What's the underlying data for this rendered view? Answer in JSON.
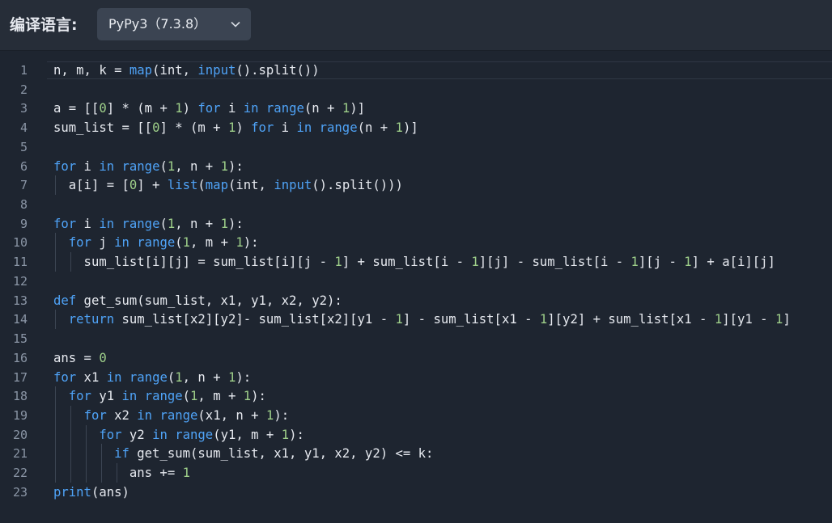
{
  "header": {
    "lang_label": "编译语言:",
    "selected_language": "PyPy3（7.3.8）"
  },
  "icons": {
    "dropdown": "chevron-down-icon"
  },
  "colors": {
    "background": "#1e2530",
    "keyword": "#4fa3f7",
    "number": "#9fd08a",
    "text": "#e6e9ef"
  },
  "editor": {
    "lines": [
      {
        "num": "1",
        "code": "n, m, k = map(int, input().split())"
      },
      {
        "num": "2",
        "code": ""
      },
      {
        "num": "3",
        "code": "a = [[0] * (m + 1) for i in range(n + 1)]"
      },
      {
        "num": "4",
        "code": "sum_list = [[0] * (m + 1) for i in range(n + 1)]"
      },
      {
        "num": "5",
        "code": ""
      },
      {
        "num": "6",
        "code": "for i in range(1, n + 1):"
      },
      {
        "num": "7",
        "code": "  a[i] = [0] + list(map(int, input().split()))"
      },
      {
        "num": "8",
        "code": ""
      },
      {
        "num": "9",
        "code": "for i in range(1, n + 1):"
      },
      {
        "num": "10",
        "code": "  for j in range(1, m + 1):"
      },
      {
        "num": "11",
        "code": "    sum_list[i][j] = sum_list[i][j - 1] + sum_list[i - 1][j] - sum_list[i - 1][j - 1] + a[i][j]"
      },
      {
        "num": "12",
        "code": ""
      },
      {
        "num": "13",
        "code": "def get_sum(sum_list, x1, y1, x2, y2):"
      },
      {
        "num": "14",
        "code": "  return sum_list[x2][y2]- sum_list[x2][y1 - 1] - sum_list[x1 - 1][y2] + sum_list[x1 - 1][y1 - 1]"
      },
      {
        "num": "15",
        "code": ""
      },
      {
        "num": "16",
        "code": "ans = 0"
      },
      {
        "num": "17",
        "code": "for x1 in range(1, n + 1):"
      },
      {
        "num": "18",
        "code": "  for y1 in range(1, m + 1):"
      },
      {
        "num": "19",
        "code": "    for x2 in range(x1, n + 1):"
      },
      {
        "num": "20",
        "code": "      for y2 in range(y1, m + 1):"
      },
      {
        "num": "21",
        "code": "        if get_sum(sum_list, x1, y1, x2, y2) <= k:"
      },
      {
        "num": "22",
        "code": "          ans += 1"
      },
      {
        "num": "23",
        "code": "print(ans)"
      }
    ]
  }
}
